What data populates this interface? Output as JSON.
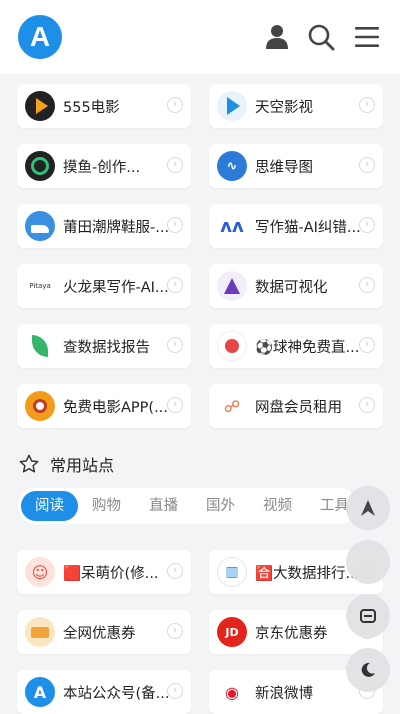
{
  "header": {
    "logo_text": "A",
    "icons": [
      "user-icon",
      "search-icon",
      "menu-icon"
    ]
  },
  "top_sites": [
    {
      "label": "555电影",
      "icon": "555-movie-icon",
      "color": "#f3a21b"
    },
    {
      "label": "天空影视",
      "icon": "play-icon",
      "color": "#1d8fe6"
    },
    {
      "label": "摸鱼-创作...",
      "icon": "moyu-icon",
      "color": "#222222",
      "emoji": "👾"
    },
    {
      "label": "思维导图",
      "icon": "mindmap-icon",
      "color": "#2d7bd8"
    },
    {
      "label": "莆田潮牌鞋服-...",
      "icon": "shoe-icon",
      "color": "#3a8fe0"
    },
    {
      "label": "写作猫-AI纠错...",
      "icon": "xiezuomao-icon",
      "color": "#2b5fd8"
    },
    {
      "label": "火龙果写作-AI...",
      "icon": "pitaya-icon",
      "color": "#e23b3b"
    },
    {
      "label": "数据可视化",
      "icon": "dataviz-icon",
      "color": "#6b3bbf"
    },
    {
      "label": "查数据找报告",
      "icon": "leaf-icon",
      "color": "#35b56a"
    },
    {
      "label": "⚽球神免费直...",
      "icon": "ball-icon",
      "color": "#e84545"
    },
    {
      "label": "免费电影APP(...",
      "icon": "film-icon",
      "color": "#f39c1b"
    },
    {
      "label": "网盘会员租用",
      "icon": "netdisk-icon",
      "color": "#e86a3b"
    }
  ],
  "section": {
    "title": "常用站点",
    "icon": "star-icon"
  },
  "tabs": [
    "阅读",
    "购物",
    "直播",
    "国外",
    "视频",
    "工具"
  ],
  "active_tab": "阅读",
  "common_sites": [
    {
      "label": "🟥呆萌价(修...",
      "icon": "daimeng-icon",
      "color": "#e84c3d"
    },
    {
      "label": "🈴大数据排行...",
      "icon": "bigdata-icon",
      "color": "#1d8fe6"
    },
    {
      "label": "全网优惠券",
      "icon": "coupon-icon",
      "color": "#f2a33a"
    },
    {
      "label": "京东优惠券",
      "icon": "jd-icon",
      "color": "#e1251b"
    },
    {
      "label": "本站公众号(备...",
      "icon": "site-logo-icon",
      "color": "#1d8fe6"
    },
    {
      "label": "新浪微博",
      "icon": "weibo-icon",
      "color": "#e6162d"
    }
  ],
  "fabs": [
    "up-arrow-icon",
    "blank-icon",
    "comment-icon",
    "night-mode-icon"
  ],
  "colors": {
    "accent": "#1d8fe6",
    "background": "#f3f4f6",
    "card": "#ffffff"
  }
}
